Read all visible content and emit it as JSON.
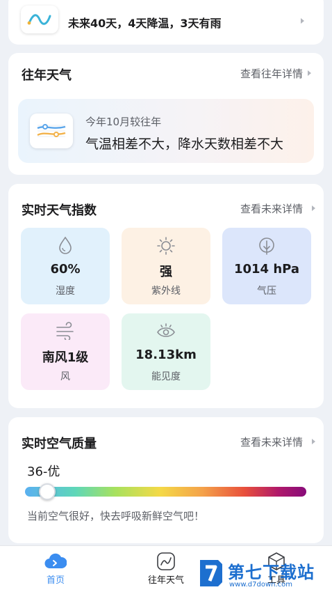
{
  "forecast": {
    "text": "未来40天，4天降温，3天有雨"
  },
  "history": {
    "title": "往年天气",
    "link": "查看往年详情",
    "subtitle": "今年10月较往年",
    "summary": "气温相差不大，降水天数相差不大"
  },
  "index": {
    "title": "实时天气指数",
    "link": "查看未来详情",
    "tiles": [
      {
        "value": "60%",
        "label": "湿度",
        "icon": "water-drop-icon",
        "bg": "#e1f1fc"
      },
      {
        "value": "强",
        "label": "紫外线",
        "icon": "sun-icon",
        "bg": "#fdf1e4"
      },
      {
        "value": "1014 hPa",
        "label": "气压",
        "icon": "pressure-gauge-icon",
        "bg": "#dce6fb"
      },
      {
        "value": "南风1级",
        "label": "风",
        "icon": "wind-icon",
        "bg": "#fbeaf8"
      },
      {
        "value": "18.13km",
        "label": "能见度",
        "icon": "eye-icon",
        "bg": "#e3f6ef"
      }
    ]
  },
  "air": {
    "title": "实时空气质量",
    "link": "查看未来详情",
    "aqi_text": "36-优",
    "aqi_value": 36,
    "aqi_scale_max": 500,
    "description": "当前空气很好，快去呼吸新鲜空气吧！"
  },
  "nav": {
    "items": [
      {
        "label": "首页",
        "icon": "home-cloud-icon",
        "active": true
      },
      {
        "label": "往年天气",
        "icon": "history-chart-icon",
        "active": false
      },
      {
        "label": "工具",
        "icon": "tools-icon",
        "active": false
      }
    ],
    "active_color": "#3b8df0",
    "inactive_color": "#1c1c1e"
  },
  "watermark": {
    "main": "第七下载站",
    "sub": "www.d7down.com"
  }
}
